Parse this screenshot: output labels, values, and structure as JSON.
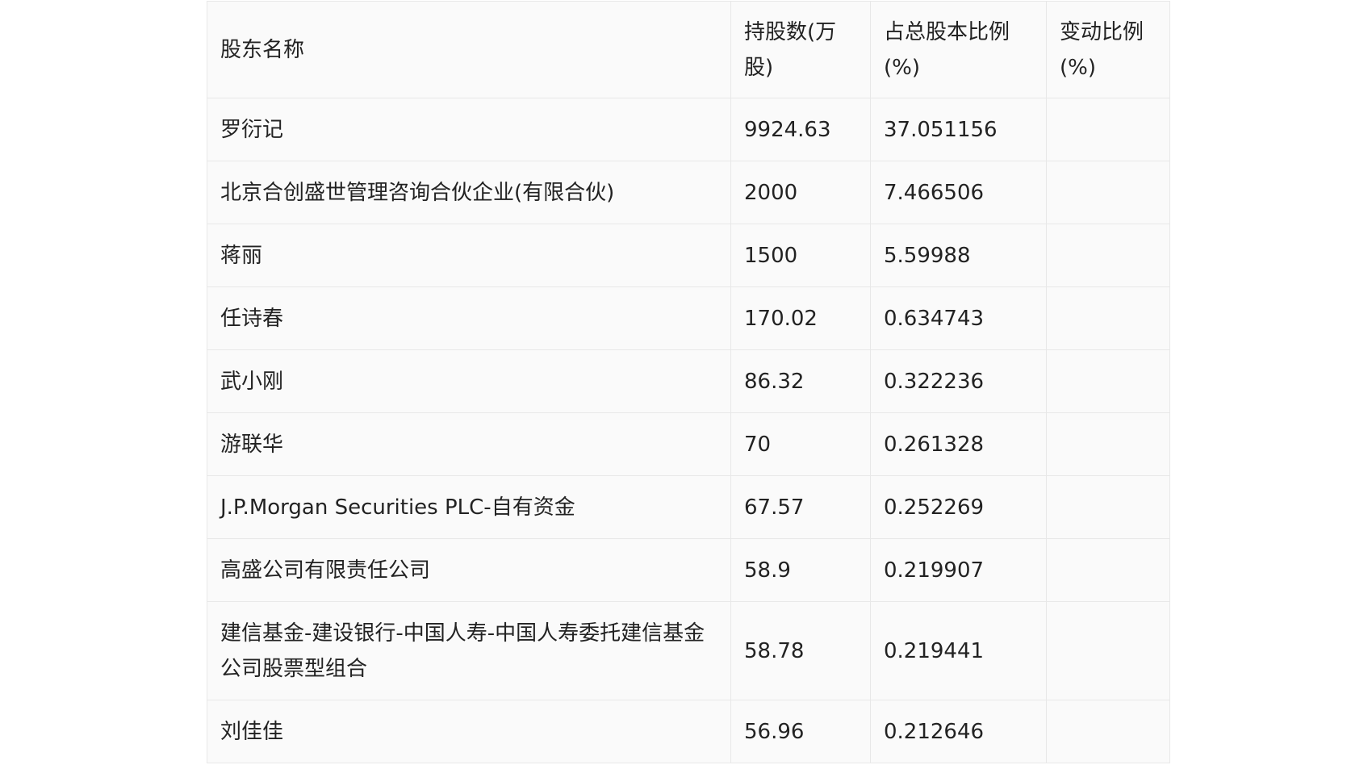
{
  "table": {
    "headers": [
      "股东名称",
      "持股数(万股)",
      "占总股本比例(%)",
      "变动比例(%)"
    ],
    "rows": [
      {
        "name": "罗衍记",
        "shares": "9924.63",
        "ratio": "37.051156",
        "change": ""
      },
      {
        "name": "北京合创盛世管理咨询合伙企业(有限合伙)",
        "shares": "2000",
        "ratio": "7.466506",
        "change": ""
      },
      {
        "name": "蒋丽",
        "shares": "1500",
        "ratio": "5.59988",
        "change": ""
      },
      {
        "name": "任诗春",
        "shares": "170.02",
        "ratio": "0.634743",
        "change": ""
      },
      {
        "name": "武小刚",
        "shares": "86.32",
        "ratio": "0.322236",
        "change": ""
      },
      {
        "name": "游联华",
        "shares": "70",
        "ratio": "0.261328",
        "change": ""
      },
      {
        "name": "J.P.Morgan Securities PLC-自有资金",
        "shares": "67.57",
        "ratio": "0.252269",
        "change": ""
      },
      {
        "name": "高盛公司有限责任公司",
        "shares": "58.9",
        "ratio": "0.219907",
        "change": ""
      },
      {
        "name": "建信基金-建设银行-中国人寿-中国人寿委托建信基金公司股票型组合",
        "shares": "58.78",
        "ratio": "0.219441",
        "change": ""
      },
      {
        "name": "刘佳佳",
        "shares": "56.96",
        "ratio": "0.212646",
        "change": ""
      }
    ]
  }
}
